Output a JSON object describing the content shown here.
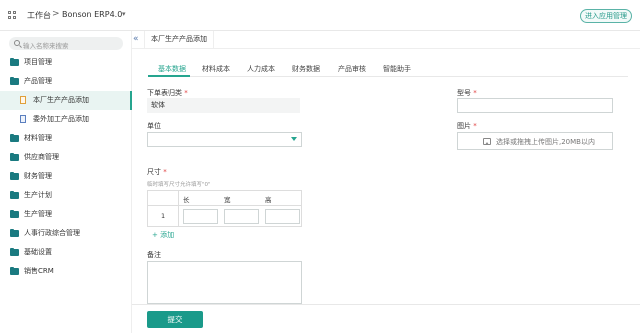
{
  "header": {
    "home": "工作台",
    "separator": ">",
    "app_name": "Bonson ERP4.0",
    "enter_app_mgmt": "进入应用管理"
  },
  "sidebar": {
    "search_placeholder": "输入名称来搜索",
    "items": [
      {
        "label": "项目管理",
        "type": "folder"
      },
      {
        "label": "产品管理",
        "type": "folder"
      },
      {
        "label": "本厂生产产品添加",
        "type": "page",
        "active": true
      },
      {
        "label": "委外加工产品添加",
        "type": "page"
      },
      {
        "label": "材料管理",
        "type": "folder"
      },
      {
        "label": "供应商管理",
        "type": "folder"
      },
      {
        "label": "财务管理",
        "type": "folder"
      },
      {
        "label": "生产计划",
        "type": "folder"
      },
      {
        "label": "生产管理",
        "type": "folder"
      },
      {
        "label": "人事行政综合管理",
        "type": "folder"
      },
      {
        "label": "基础设置",
        "type": "folder"
      },
      {
        "label": "销售CRM",
        "type": "folder"
      }
    ]
  },
  "page_tab": "本厂生产产品添加",
  "subtabs": [
    "基本数据",
    "材料成本",
    "人力成本",
    "财务数据",
    "产品审核",
    "智能助手"
  ],
  "form": {
    "category_label": "下单表归类",
    "category_value": "软体",
    "model_label": "型号",
    "unit_label": "单位",
    "image_label": "图片",
    "upload_text": "选择或拖拽上传图片,20MB以内",
    "size_label": "尺寸",
    "size_hint": "临时填写尺寸允许填写\"0\"",
    "size_headers": [
      "长",
      "宽",
      "高"
    ],
    "size_row_number": "1",
    "add_link": "+ 添加",
    "remark_label": "备注",
    "required_mark": "*"
  },
  "footer": {
    "submit": "提交"
  },
  "colors": {
    "accent": "#26a58f",
    "submit_bg": "#1a9a8a",
    "folder": "#1a7a80",
    "required": "#e04040"
  }
}
